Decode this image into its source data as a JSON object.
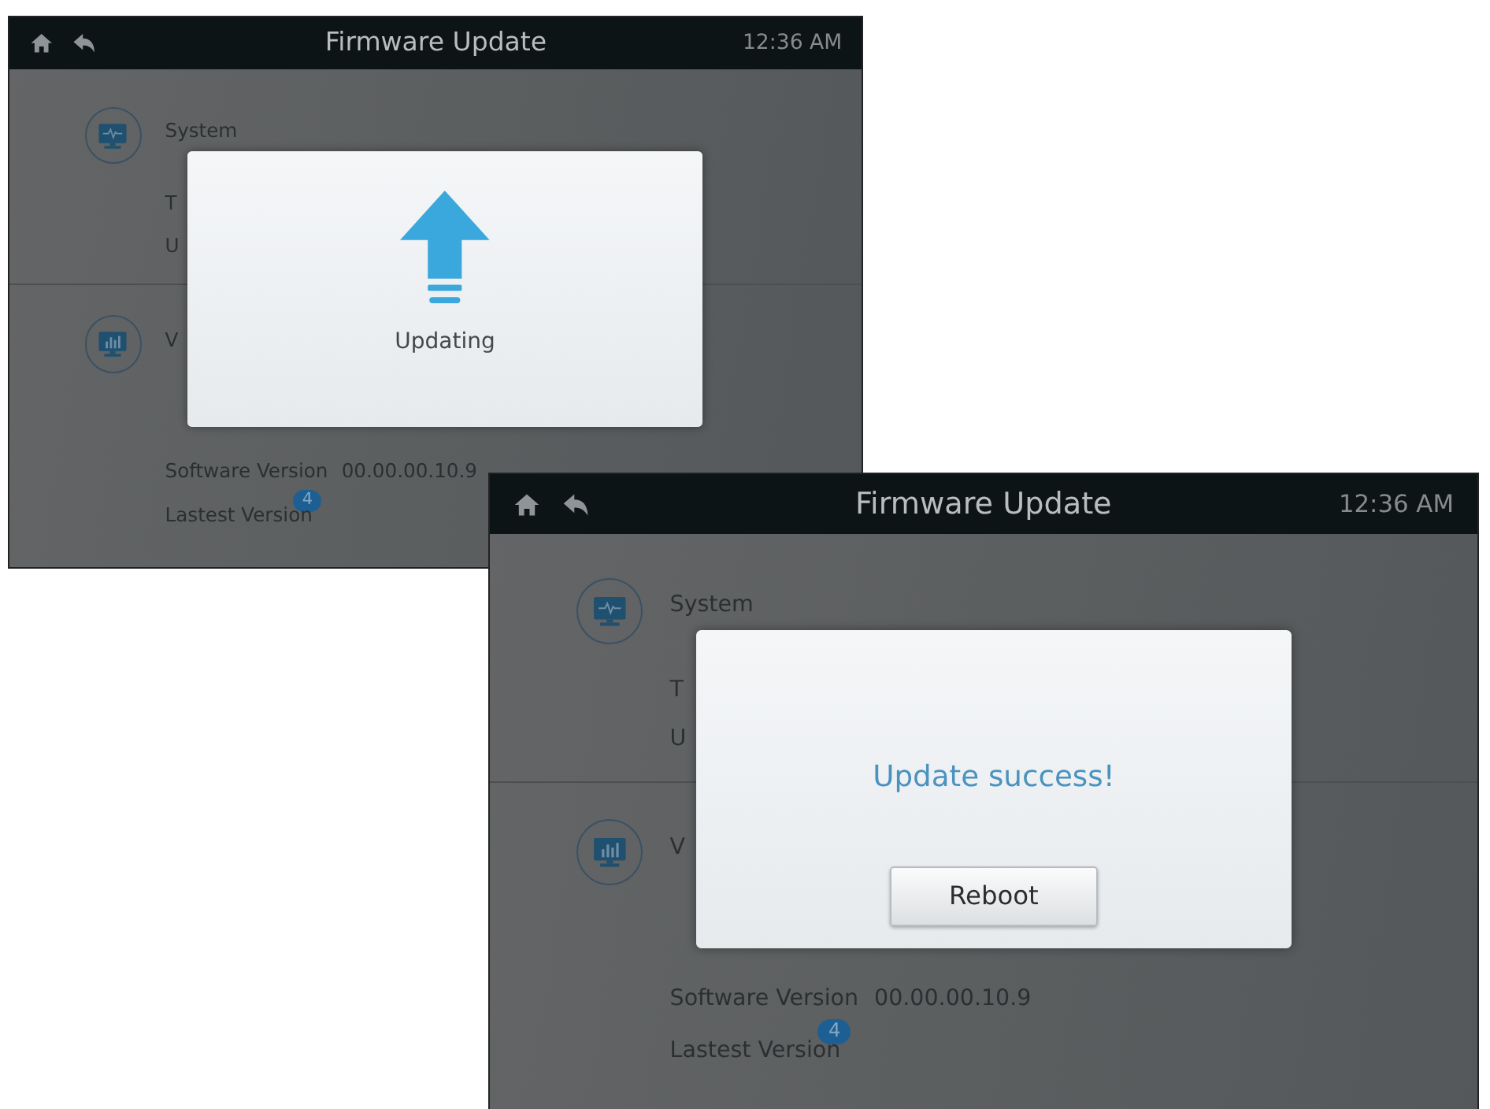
{
  "screens": [
    {
      "header": {
        "title": "Firmware Update",
        "time": "12:36 AM"
      },
      "system": {
        "title": "System",
        "cut_lines": [
          "T",
          "U"
        ]
      },
      "version": {
        "cut_title": "V",
        "software_label": "Software Version",
        "software_value": "00.00.00.10.9",
        "badge": "4",
        "latest_label": "Lastest Version"
      },
      "dialog": {
        "kind": "progress",
        "message": "Updating"
      }
    },
    {
      "header": {
        "title": "Firmware Update",
        "time": "12:36 AM"
      },
      "system": {
        "title": "System",
        "cut_lines": [
          "T",
          "U"
        ]
      },
      "version": {
        "cut_title": "V",
        "software_label": "Software Version",
        "software_value": "00.00.00.10.9",
        "badge": "4",
        "latest_label": "Lastest Version"
      },
      "dialog": {
        "kind": "result",
        "message": "Update success!",
        "button": "Reboot"
      }
    }
  ]
}
